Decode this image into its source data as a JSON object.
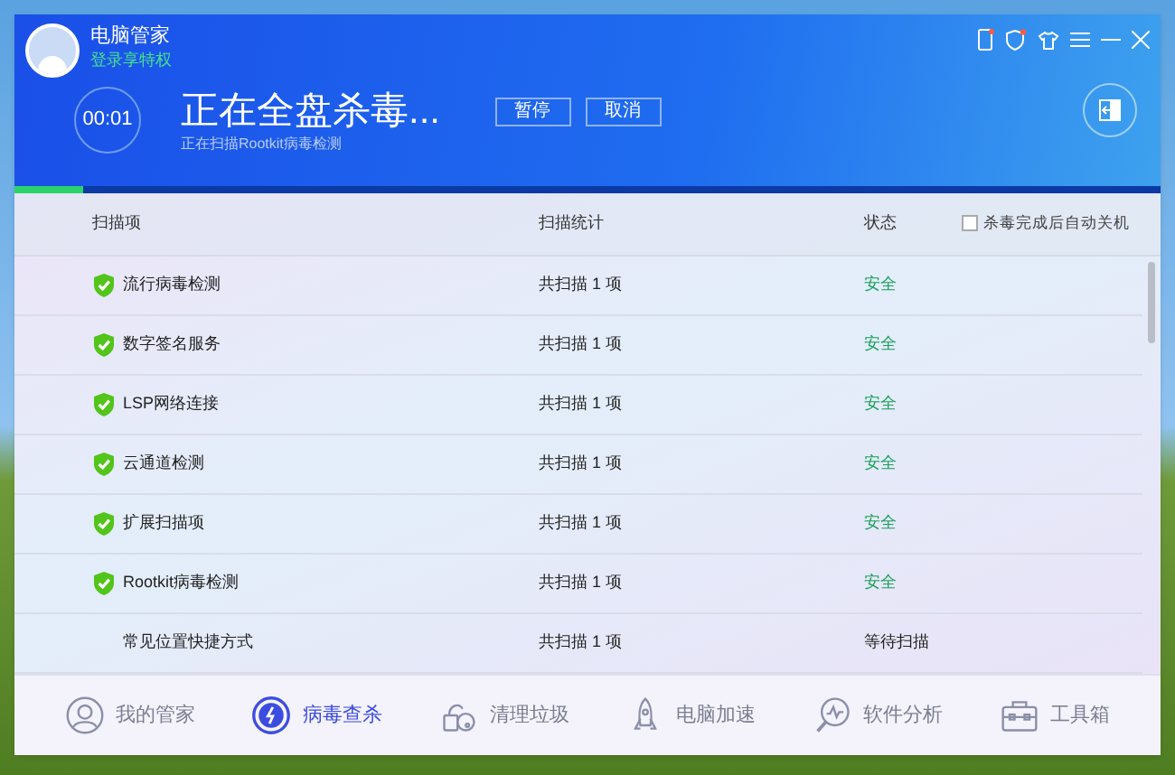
{
  "window": {
    "app_name": "电脑管家",
    "login_link": "登录享特权"
  },
  "scan": {
    "timer": "00:01",
    "title": "正在全盘杀毒...",
    "subtitle": "正在扫描Rootkit病毒检测",
    "level": 0.06,
    "buttons": [
      "暂停",
      "取消"
    ]
  },
  "table": {
    "columns": [
      "扫描项",
      "扫描统计",
      "状态"
    ],
    "auto_shutdown": {
      "label": "杀毒完成后自动关机",
      "checked": false
    },
    "rows": [
      {
        "kind": "done",
        "item": "流行病毒检测",
        "count": "共扫描 1 项",
        "status": "安全"
      },
      {
        "kind": "done",
        "item": "数字签名服务",
        "count": "共扫描 1 项",
        "status": "安全"
      },
      {
        "kind": "done",
        "item": "LSP网络连接",
        "count": "共扫描 1 项",
        "status": "安全"
      },
      {
        "kind": "done",
        "item": "云通道检测",
        "count": "共扫描 1 项",
        "status": "安全"
      },
      {
        "kind": "done",
        "item": "扩展扫描项",
        "count": "共扫描 1 项",
        "status": "安全"
      },
      {
        "kind": "done",
        "item": "Rootkit病毒检测",
        "count": "共扫描 1 项",
        "status": "安全"
      },
      {
        "kind": "pending",
        "item": "常见位置快捷方式",
        "count": "共扫描 1 项",
        "status": "等待扫描"
      }
    ]
  },
  "nav": [
    {
      "kind": "home",
      "label": "我的管家",
      "selected": false
    },
    {
      "kind": "virus",
      "label": "病毒查杀",
      "selected": true
    },
    {
      "kind": "clean",
      "label": "清理垃圾",
      "selected": false
    },
    {
      "kind": "speed",
      "label": "电脑加速",
      "selected": false
    },
    {
      "kind": "software",
      "label": "软件分析",
      "selected": false
    },
    {
      "kind": "tools",
      "label": "工具箱",
      "selected": false
    }
  ]
}
